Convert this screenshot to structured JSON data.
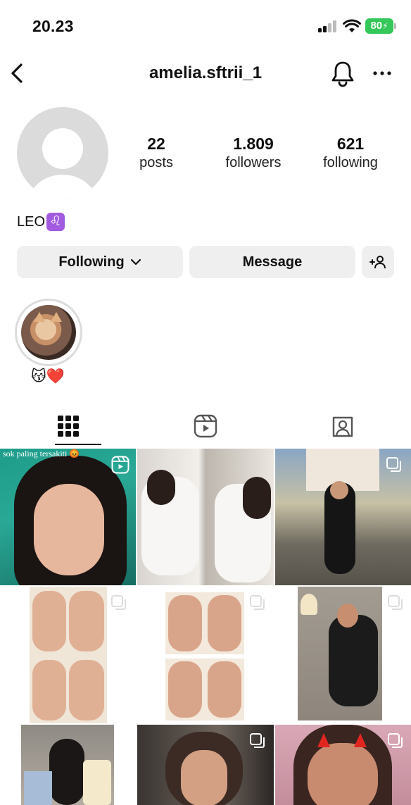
{
  "status_bar": {
    "time": "20.23",
    "battery": "80"
  },
  "header": {
    "username": "amelia.sftrii_1",
    "back_icon": "chevron-left-icon",
    "bell_icon": "bell-icon",
    "more_icon": "more-horizontal-icon"
  },
  "profile": {
    "stats": [
      {
        "value": "22",
        "label": "posts"
      },
      {
        "value": "1.809",
        "label": "followers"
      },
      {
        "value": "621",
        "label": "following"
      }
    ],
    "bio_text": "LEO",
    "bio_emoji": "♌"
  },
  "actions": {
    "following": "Following",
    "message": "Message",
    "add_user_icon": "add-person-icon"
  },
  "highlights": [
    {
      "label": "😽❤️"
    }
  ],
  "tabs": [
    {
      "name": "grid-icon",
      "active": true
    },
    {
      "name": "reels-icon",
      "active": false
    },
    {
      "name": "tagged-icon",
      "active": false
    }
  ],
  "posts": [
    {
      "type": "reel",
      "caption": "sok paling tersakiti 😡"
    },
    {
      "type": "photo",
      "caption": ""
    },
    {
      "type": "multi",
      "caption": ""
    },
    {
      "type": "multi",
      "caption": ""
    },
    {
      "type": "multi",
      "caption": ""
    },
    {
      "type": "multi",
      "caption": ""
    },
    {
      "type": "photo",
      "caption": ""
    },
    {
      "type": "multi",
      "caption": ""
    },
    {
      "type": "multi",
      "caption": ""
    }
  ],
  "colors": {
    "battery": "#34c759",
    "button_bg": "#efefef",
    "avatar_bg": "#dbdbdb",
    "bio_emoji_bg": "#a25be0"
  }
}
